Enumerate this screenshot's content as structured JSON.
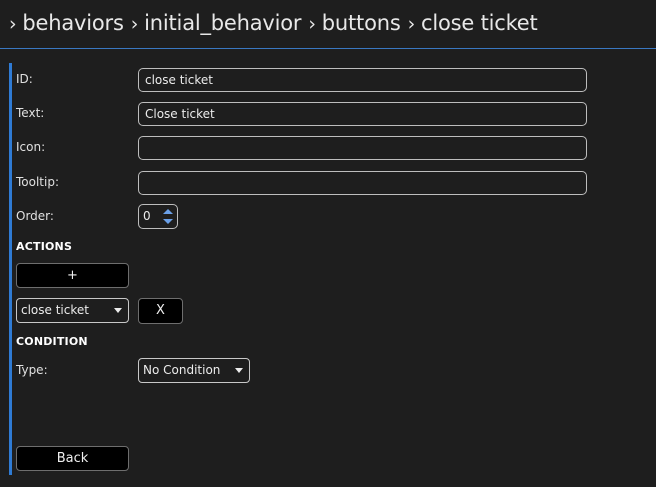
{
  "breadcrumb": {
    "items": [
      "behaviors",
      "initial_behavior",
      "buttons",
      "close ticket"
    ],
    "separator": "›"
  },
  "form": {
    "id_label": "ID:",
    "id_value": "close ticket",
    "text_label": "Text:",
    "text_value": "Close ticket",
    "icon_label": "Icon:",
    "icon_value": "",
    "tooltip_label": "Tooltip:",
    "tooltip_value": "",
    "order_label": "Order:",
    "order_value": "0"
  },
  "actions": {
    "heading": "ACTIONS",
    "add_label": "+",
    "selected_action": "close ticket",
    "remove_label": "X"
  },
  "condition": {
    "heading": "CONDITION",
    "type_label": "Type:",
    "type_value": "No Condition"
  },
  "footer": {
    "back_label": "Back"
  },
  "colors": {
    "background": "#1e1e1e",
    "accent": "#2f7bd4",
    "button_bg": "#000000"
  }
}
